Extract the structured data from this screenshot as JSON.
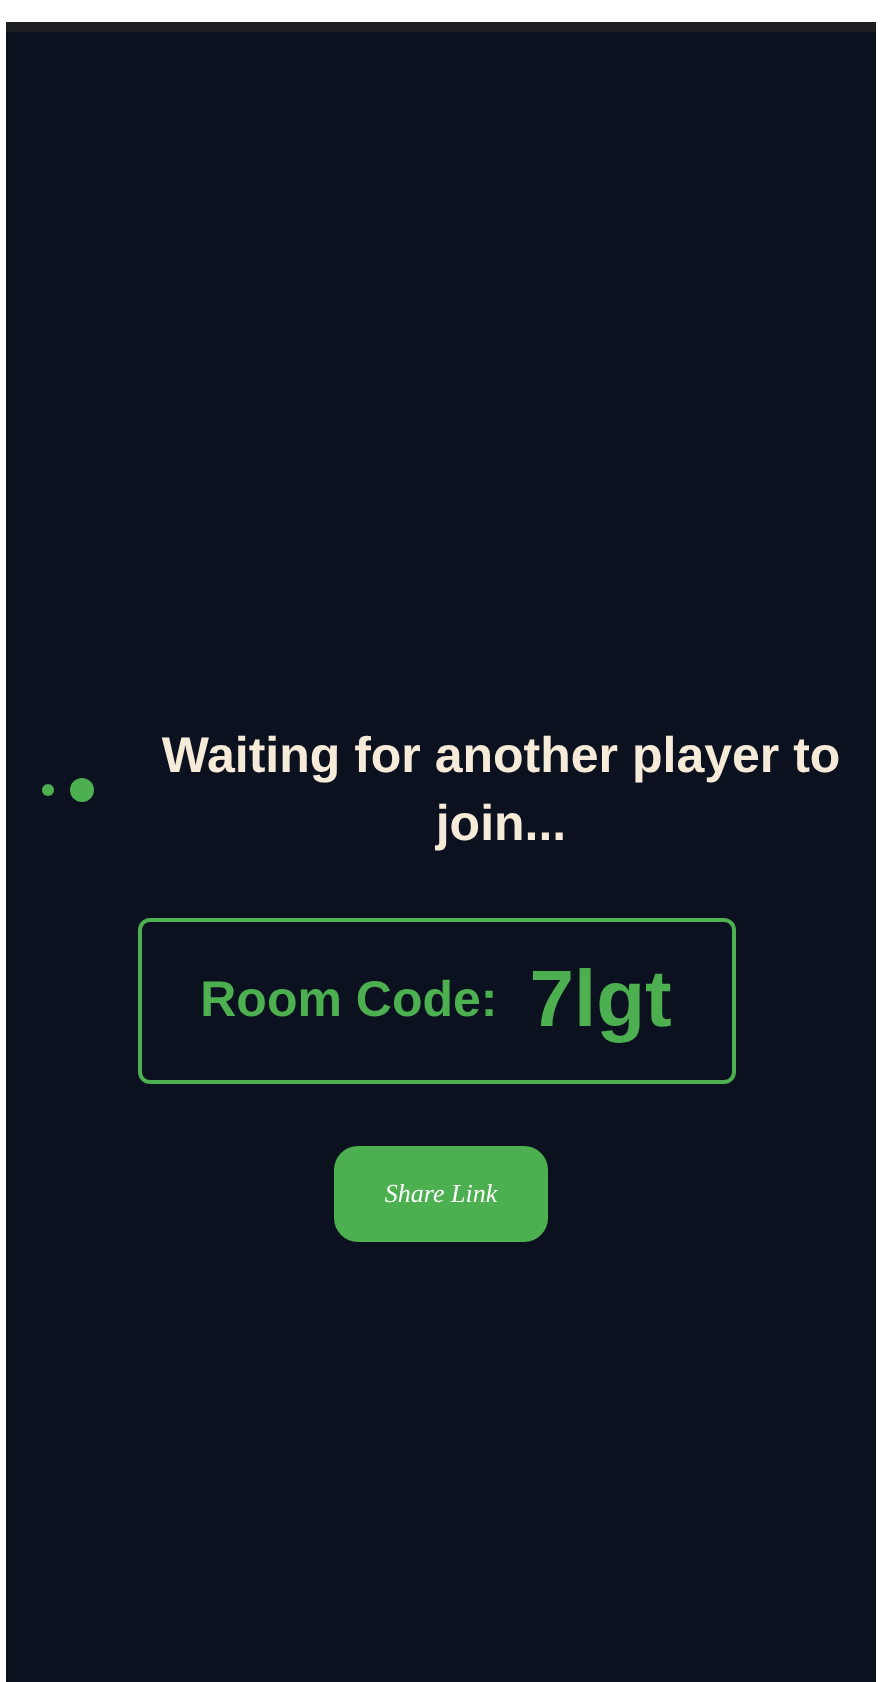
{
  "status": {
    "message": "Waiting for another player to join..."
  },
  "room_code": {
    "label": "Room Code:",
    "value": "7lgt"
  },
  "share_button": {
    "label": "Share Link"
  }
}
